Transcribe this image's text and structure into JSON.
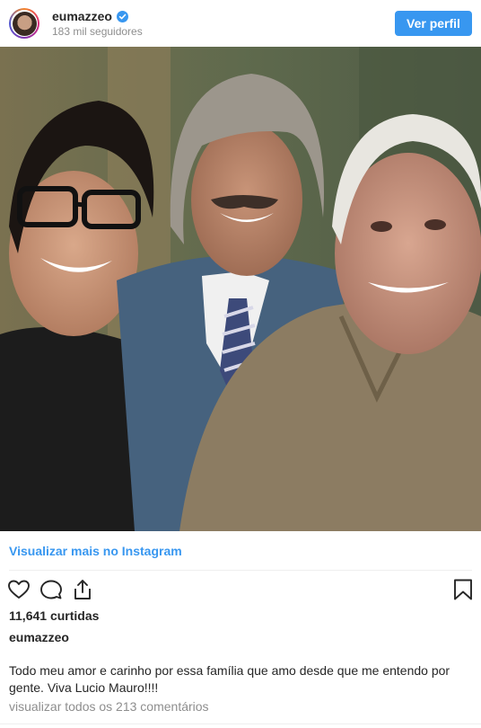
{
  "header": {
    "username": "eumazzeo",
    "followers": "183 mil seguidores",
    "view_profile_label": "Ver perfil"
  },
  "post": {
    "view_more_label": "Visualizar mais no Instagram",
    "likes": "11,641 curtidas",
    "owner": "eumazzeo",
    "caption": "Todo meu amor e carinho por essa família que amo desde que me entendo por gente. Viva Lucio Mauro!!!!",
    "comments_link": "visualizar todos os 213 comentários"
  },
  "icons": {
    "verified": "verified-badge-icon",
    "like": "heart-icon",
    "comment": "comment-bubble-icon",
    "share": "share-icon",
    "save": "bookmark-icon"
  },
  "colors": {
    "accent": "#3897f0",
    "text": "#262626",
    "muted": "#8e8e8e"
  }
}
